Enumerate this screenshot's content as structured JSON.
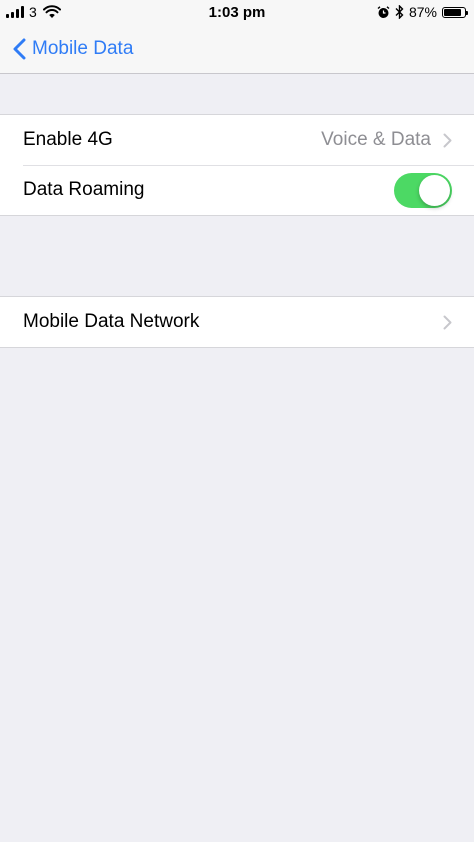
{
  "status_bar": {
    "carrier": "3",
    "time": "1:03 pm",
    "battery_percent": "87%",
    "battery_level": 0.87,
    "icons": [
      "signal-icon",
      "wifi-icon",
      "alarm-icon",
      "bluetooth-icon",
      "battery-icon"
    ]
  },
  "nav": {
    "back_label": "Mobile Data"
  },
  "settings": {
    "enable_4g": {
      "label": "Enable 4G",
      "value": "Voice & Data"
    },
    "data_roaming": {
      "label": "Data Roaming",
      "on": true
    },
    "mobile_data_network": {
      "label": "Mobile Data Network"
    }
  },
  "colors": {
    "accent": "#2f7cf6",
    "toggle_on": "#4cd964",
    "background": "#efeff4"
  }
}
